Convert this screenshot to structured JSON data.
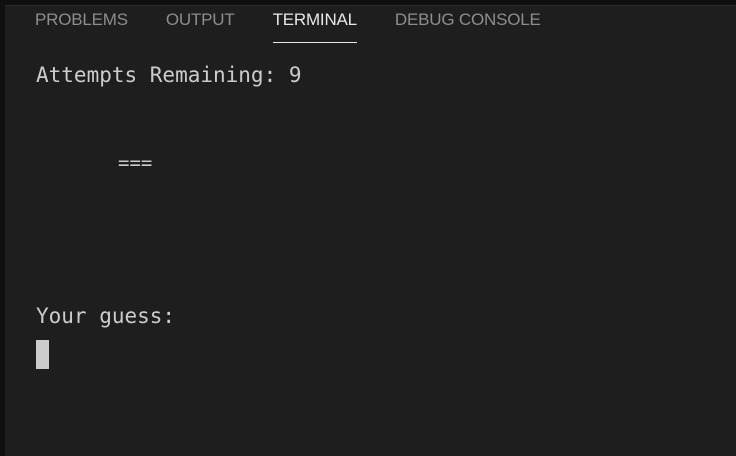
{
  "panel": {
    "tabs": [
      {
        "label": "PROBLEMS",
        "active": false
      },
      {
        "label": "OUTPUT",
        "active": false
      },
      {
        "label": "TERMINAL",
        "active": true
      },
      {
        "label": "DEBUG CONSOLE",
        "active": false
      }
    ]
  },
  "terminal": {
    "attempts_line": "Attempts Remaining: 9",
    "word_display": "===",
    "prompt": "Your guess:"
  },
  "colors": {
    "background": "#1e1e1e",
    "text": "#cccccc",
    "active_tab": "#e7e7e7",
    "inactive_tab": "#8d8d8d"
  }
}
